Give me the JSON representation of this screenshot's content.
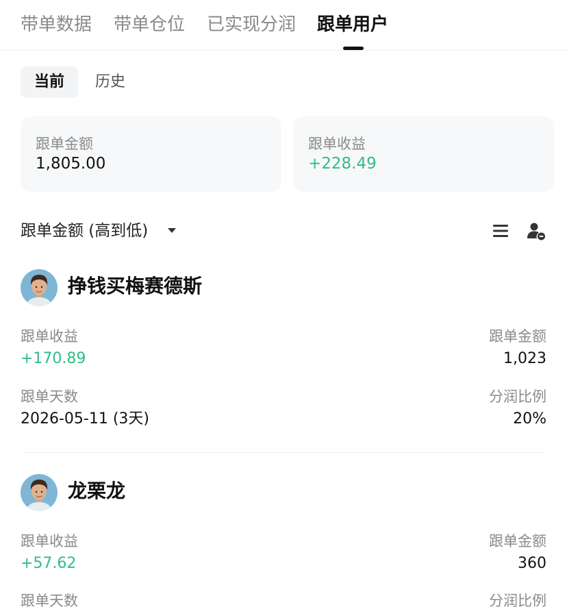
{
  "tabs": [
    {
      "label": "带单数据"
    },
    {
      "label": "带单仓位"
    },
    {
      "label": "已实现分润"
    },
    {
      "label": "跟单用户"
    }
  ],
  "segments": {
    "current": "当前",
    "history": "历史"
  },
  "summary": {
    "amount_label": "跟单金额",
    "amount_value": "1,805.00",
    "profit_label": "跟单收益",
    "profit_value": "+228.49"
  },
  "sort": {
    "label": "跟单金额 (高到低)"
  },
  "icons": {
    "list": "list-icon",
    "user_remove": "user-remove-icon",
    "caret": "caret-down-icon"
  },
  "colors": {
    "profit_green": "#2ebd85"
  },
  "users": [
    {
      "name": "挣钱买梅赛德斯",
      "profit_label": "跟单收益",
      "profit_value": "+170.89",
      "amount_label": "跟单金额",
      "amount_value": "1,023",
      "days_label": "跟单天数",
      "days_value": "2026-05-11 (3天)",
      "ratio_label": "分润比例",
      "ratio_value": "20%"
    },
    {
      "name": "龙栗龙",
      "profit_label": "跟单收益",
      "profit_value": "+57.62",
      "amount_label": "跟单金额",
      "amount_value": "360",
      "days_label": "跟单天数",
      "ratio_label": "分润比例"
    }
  ]
}
